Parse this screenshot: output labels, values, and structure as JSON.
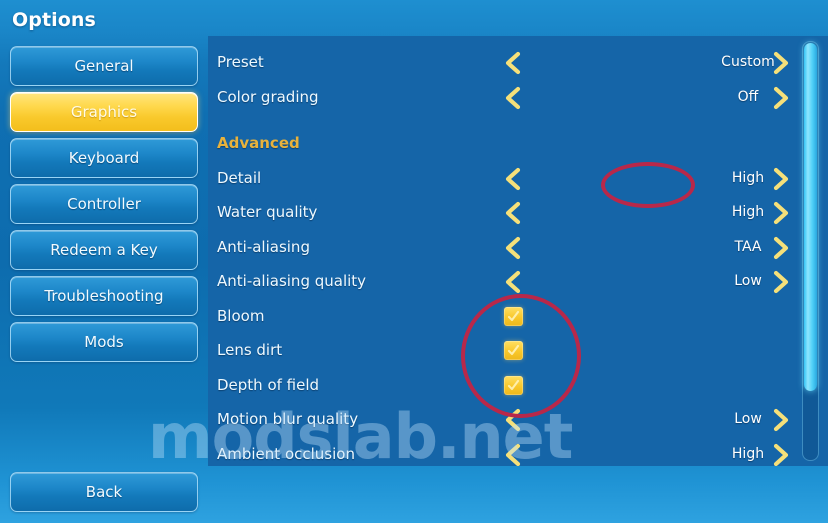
{
  "header": {
    "title": "Options"
  },
  "sidebar": {
    "items": [
      {
        "label": "General",
        "active": false
      },
      {
        "label": "Graphics",
        "active": true
      },
      {
        "label": "Keyboard",
        "active": false
      },
      {
        "label": "Controller",
        "active": false
      },
      {
        "label": "Redeem a Key",
        "active": false
      },
      {
        "label": "Troubleshooting",
        "active": false
      },
      {
        "label": "Mods",
        "active": false
      }
    ],
    "back_label": "Back"
  },
  "options": {
    "rows": [
      {
        "name": "Preset",
        "type": "selector",
        "value": "Custom"
      },
      {
        "name": "Color grading",
        "type": "selector",
        "value": "Off"
      },
      {
        "name": "",
        "type": "spacer",
        "value": ""
      },
      {
        "name": "Advanced",
        "type": "section",
        "value": ""
      },
      {
        "name": "Detail",
        "type": "selector",
        "value": "High"
      },
      {
        "name": "Water quality",
        "type": "selector",
        "value": "High"
      },
      {
        "name": "Anti-aliasing",
        "type": "selector",
        "value": "TAA"
      },
      {
        "name": "Anti-aliasing quality",
        "type": "selector",
        "value": "Low"
      },
      {
        "name": "Bloom",
        "type": "checkbox",
        "value": "checked"
      },
      {
        "name": "Lens dirt",
        "type": "checkbox",
        "value": "checked"
      },
      {
        "name": "Depth of field",
        "type": "checkbox",
        "value": "checked"
      },
      {
        "name": "Motion blur quality",
        "type": "selector",
        "value": "Low"
      },
      {
        "name": "Ambient occlusion",
        "type": "selector",
        "value": "High"
      }
    ]
  },
  "scrollbar": {
    "position": "top"
  },
  "annotations": {
    "highlight_detail_value": "Detail = High",
    "highlight_checkbox_group": "Bloom / Lens dirt / Depth of field checkboxes"
  },
  "watermark": {
    "text": "modslab.net"
  },
  "colors": {
    "background_blue": "#0d6cae",
    "panel_blue": "#1565a8",
    "accent_yellow": "#f9c82b",
    "section_heading": "#e8b23c",
    "annotation_red": "#b8284a",
    "scroll_thumb_cyan": "#4fd0f7",
    "text_white": "#ffffff"
  }
}
